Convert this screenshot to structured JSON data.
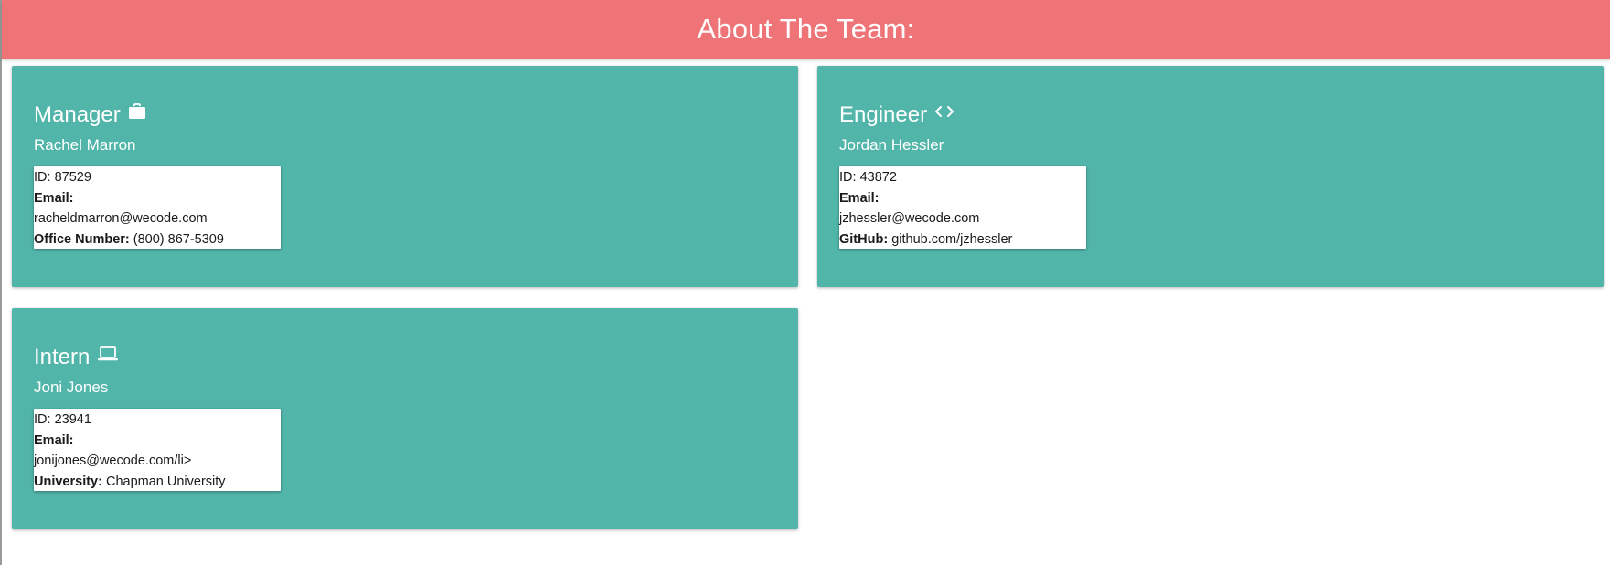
{
  "header": {
    "title": "About The Team:"
  },
  "colors": {
    "header_bg": "#ef7478",
    "card_bg": "#52b5aa"
  },
  "cards": [
    {
      "role": "Manager",
      "icon": "briefcase-icon",
      "name": "Rachel Marron",
      "id_label": "ID:",
      "id_value": "87529",
      "email_label": "Email:",
      "email_value": "racheldmarron@wecode.com",
      "extra_label": "Office Number:",
      "extra_value": "(800) 867-5309"
    },
    {
      "role": "Engineer",
      "icon": "code-icon",
      "name": "Jordan Hessler",
      "id_label": "ID:",
      "id_value": "43872",
      "email_label": "Email:",
      "email_value": "jzhessler@wecode.com",
      "extra_label": "GitHub:",
      "extra_value": "github.com/jzhessler"
    },
    {
      "role": "Intern",
      "icon": "laptop-icon",
      "name": "Joni Jones",
      "id_label": "ID:",
      "id_value": "23941",
      "email_label": "Email:",
      "email_value": "jonijones@wecode.com/li>",
      "extra_label": "University:",
      "extra_value": "Chapman University"
    }
  ]
}
